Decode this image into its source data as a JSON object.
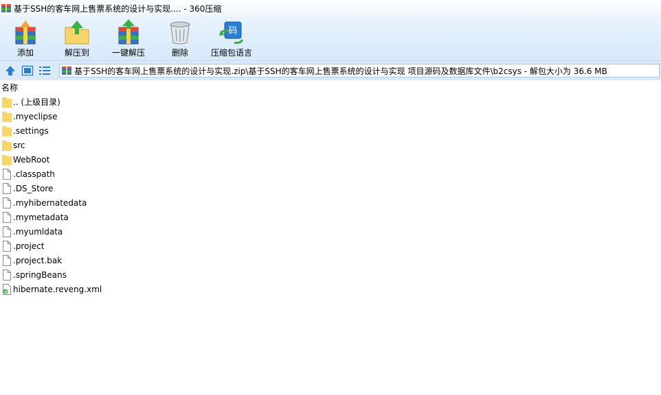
{
  "window": {
    "title": "基于SSH的客车网上售票系统的设计与实现.... - 360压缩"
  },
  "toolbar": {
    "buttons": [
      {
        "label": "添加",
        "icon": "add-archive-icon"
      },
      {
        "label": "解压到",
        "icon": "extract-to-icon"
      },
      {
        "label": "一键解压",
        "icon": "one-click-extract-icon"
      },
      {
        "label": "删除",
        "icon": "trash-icon"
      },
      {
        "label": "压缩包语言",
        "icon": "archive-language-icon"
      }
    ]
  },
  "address": {
    "path": "基于SSH的客车网上售票系统的设计与实现.zip\\基于SSH的客车网上售票系统的设计与实现 项目源码及数据库文件\\b2csys - 解包大小为 36.6 MB"
  },
  "list": {
    "column_name": "名称",
    "items": [
      {
        "name": ".. (上级目录)",
        "type": "folder"
      },
      {
        "name": ".myeclipse",
        "type": "folder"
      },
      {
        "name": ".settings",
        "type": "folder"
      },
      {
        "name": "src",
        "type": "folder"
      },
      {
        "name": "WebRoot",
        "type": "folder"
      },
      {
        "name": ".classpath",
        "type": "file"
      },
      {
        "name": ".DS_Store",
        "type": "file"
      },
      {
        "name": ".myhibernatedata",
        "type": "file"
      },
      {
        "name": ".mymetadata",
        "type": "file"
      },
      {
        "name": ".myumldata",
        "type": "file"
      },
      {
        "name": ".project",
        "type": "file"
      },
      {
        "name": ".project.bak",
        "type": "file"
      },
      {
        "name": ".springBeans",
        "type": "file"
      },
      {
        "name": "hibernate.reveng.xml",
        "type": "xml"
      }
    ]
  },
  "colors": {
    "toolbar_bg": "#d7e9f9",
    "folder": "#f7d56b",
    "accent": "#2a7fd4"
  }
}
